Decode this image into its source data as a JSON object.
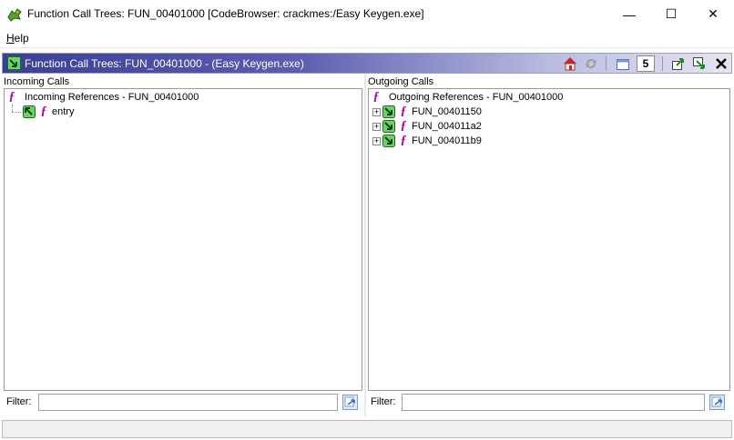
{
  "window": {
    "title": "Function Call Trees: FUN_00401000 [CodeBrowser: crackmes:/Easy Keygen.exe]",
    "minimize_glyph": "—",
    "maximize_glyph": "☐",
    "close_glyph": "✕"
  },
  "menu": {
    "help_mnemonic": "H",
    "help_rest": "elp"
  },
  "provider": {
    "title": "Function Call Trees: FUN_00401000 -  (Easy Keygen.exe)",
    "depth_value": "5",
    "toolbar_icons": [
      "home-icon",
      "refresh-icon",
      "window-icon",
      "depth-field",
      "navigate-incoming-icon",
      "navigate-outgoing-icon",
      "close-icon"
    ]
  },
  "incoming": {
    "label": "Incoming Calls",
    "root": "Incoming References - FUN_00401000",
    "children": [
      "entry"
    ],
    "filter_label": "Filter:",
    "filter_value": ""
  },
  "outgoing": {
    "label": "Outgoing Calls",
    "root": "Outgoing References - FUN_00401000",
    "children": [
      "FUN_00401150",
      "FUN_004011a2",
      "FUN_004011b9"
    ],
    "filter_label": "Filter:",
    "filter_value": ""
  },
  "colors": {
    "function_glyph": "#b000b0",
    "header_start": "#3b3f95",
    "arrow_green": "#2e9e2e"
  }
}
